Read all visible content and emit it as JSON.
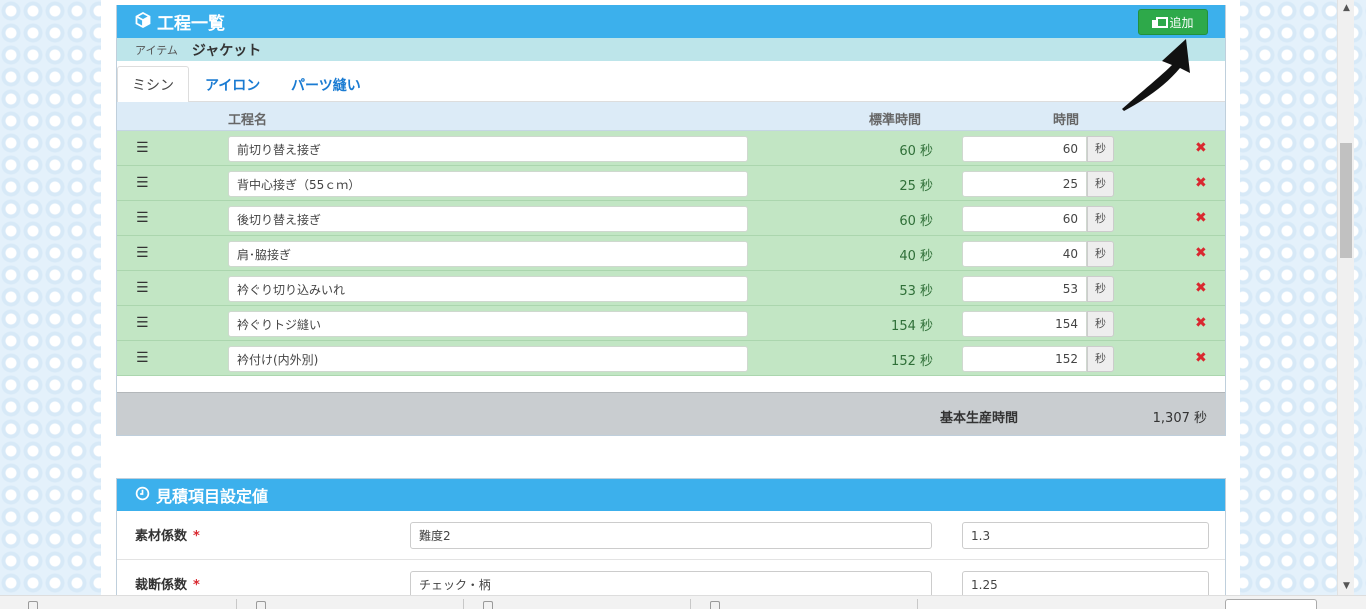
{
  "process_panel": {
    "title": "工程一覧",
    "add_label": "追加",
    "item_label": "アイテム",
    "item_value": "ジャケット",
    "tabs": [
      {
        "label": "ミシン"
      },
      {
        "label": "アイロン"
      },
      {
        "label": "パーツ縫い"
      }
    ],
    "columns": {
      "name": "工程名",
      "standard_time": "標準時間",
      "time": "時間"
    },
    "rows": [
      {
        "name": "前切り替え接ぎ",
        "standard_time": "60 秒",
        "time": "60",
        "unit": "秒"
      },
      {
        "name": "背中心接ぎ（55ｃｍ）",
        "standard_time": "25 秒",
        "time": "25",
        "unit": "秒"
      },
      {
        "name": "後切り替え接ぎ",
        "standard_time": "60 秒",
        "time": "60",
        "unit": "秒"
      },
      {
        "name": "肩･脇接ぎ",
        "standard_time": "40 秒",
        "time": "40",
        "unit": "秒"
      },
      {
        "name": "衿ぐり切り込みいれ",
        "standard_time": "53 秒",
        "time": "53",
        "unit": "秒"
      },
      {
        "name": "衿ぐりトジ縫い",
        "standard_time": "154 秒",
        "time": "154",
        "unit": "秒"
      },
      {
        "name": "衿付け(内外別)",
        "standard_time": "152 秒",
        "time": "152",
        "unit": "秒"
      }
    ],
    "total_label": "基本生産時間",
    "total_value": "1,307 秒"
  },
  "estimate_panel": {
    "title": "見積項目設定値",
    "rows": [
      {
        "label": "素材係数",
        "required": "*",
        "select_value": "難度2",
        "number_value": "1.3"
      },
      {
        "label": "裁断係数",
        "required": "*",
        "select_value": "チェック・柄",
        "number_value": "1.25"
      }
    ]
  },
  "icons": {
    "panel_icon": "cube-icon",
    "add_icon": "copy-plus-icon",
    "drag_icon": "bars-icon",
    "delete_icon": "times-icon",
    "estimate_icon": "clock-icon",
    "annotation": "arrow-annotation"
  },
  "colors": {
    "header_blue": "#3cb0ec",
    "item_bar": "#bde5ea",
    "row_green": "#c2e6c4",
    "add_button": "#2ea94a",
    "delete_red": "#d9282f",
    "total_bar": "#c9cdd0"
  }
}
